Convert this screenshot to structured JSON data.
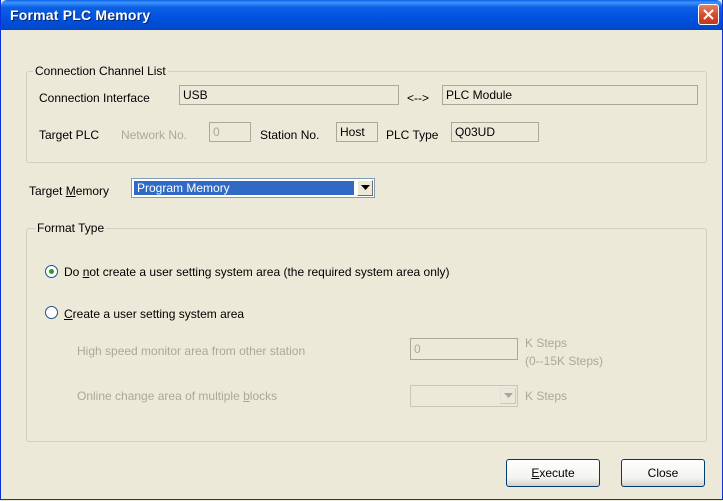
{
  "window": {
    "title": "Format PLC Memory"
  },
  "connection": {
    "group_label": "Connection Channel List",
    "interface_label": "Connection Interface",
    "interface_value": "USB",
    "arrow": "<-->",
    "module_value": "PLC Module",
    "target_plc_label": "Target PLC",
    "network_label": "Network No.",
    "network_value": "0",
    "station_label": "Station No.",
    "station_value": "Host",
    "plc_type_label": "PLC Type",
    "plc_type_value": "Q03UD"
  },
  "target_memory": {
    "label_pre": "Target ",
    "label_accel": "M",
    "label_post": "emory",
    "selected": "Program Memory"
  },
  "format_type": {
    "group_label": "Format Type",
    "option1": {
      "pre": "Do ",
      "accel": "n",
      "post": "ot create a user setting system area (the required system area only)",
      "selected": true
    },
    "option2": {
      "accel": "C",
      "post": "reate a user setting system area",
      "selected": false
    },
    "hs_monitor_label": "High speed monitor area from other station",
    "hs_monitor_value": "0",
    "hs_monitor_unit": "K Steps",
    "hs_monitor_range": "(0--15K Steps)",
    "online_label_pre": "Online change area of multiple ",
    "online_label_accel": "b",
    "online_label_post": "locks",
    "online_value": "",
    "online_unit": "K Steps"
  },
  "buttons": {
    "execute_accel": "E",
    "execute_rest": "xecute",
    "close": "Close"
  },
  "colors": {
    "title_bar": "#0054e3",
    "dialog_bg": "#ece9d8",
    "selection": "#316ac5"
  }
}
